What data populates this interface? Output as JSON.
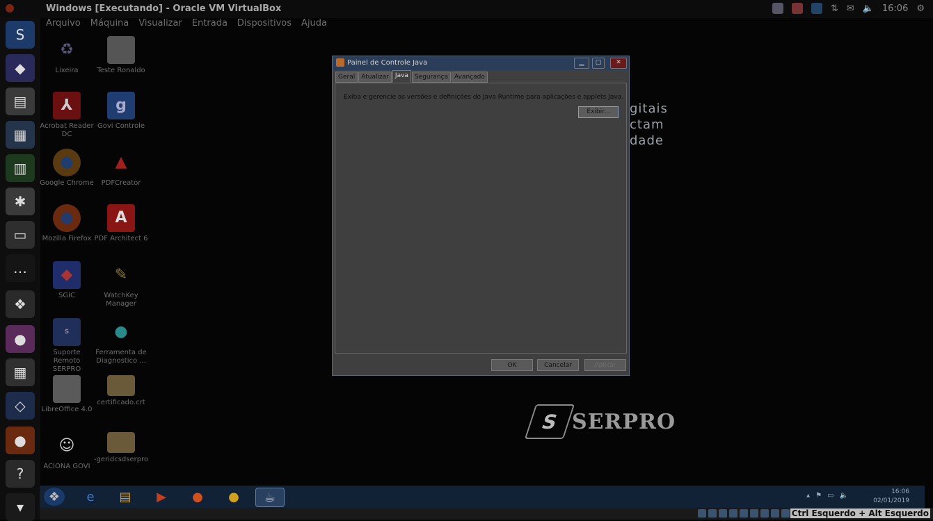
{
  "top_bar": {
    "window_title": "Windows [Executando] - Oracle VM VirtualBox",
    "clock": "16:06"
  },
  "menu": [
    "Arquivo",
    "Máquina",
    "Visualizar",
    "Entrada",
    "Dispositivos",
    "Ajuda"
  ],
  "desktop_icons": [
    {
      "label": "Lixeira",
      "icon": "recycle-bin-icon"
    },
    {
      "label": "Teste Ronaldo",
      "icon": "document-icon"
    },
    {
      "label": "Acrobat Reader DC",
      "icon": "acrobat-icon"
    },
    {
      "label": "Govi Controle",
      "icon": "govi-icon"
    },
    {
      "label": "Google Chrome",
      "icon": "chrome-icon"
    },
    {
      "label": "PDFCreator",
      "icon": "pdfcreator-icon"
    },
    {
      "label": "Mozilla Firefox",
      "icon": "firefox-icon"
    },
    {
      "label": "PDF Architect 6",
      "icon": "pdf-architect-icon"
    },
    {
      "label": "SGIC",
      "icon": "sgic-icon"
    },
    {
      "label": "WatchKey Manager",
      "icon": "watchkey-icon"
    },
    {
      "label": "Suporte Remoto SERPRO",
      "icon": "suporte-remoto-icon"
    },
    {
      "label": "Ferramenta de Diagnostico ...",
      "icon": "diagnostic-icon"
    },
    {
      "label": "LibreOffice 4.0",
      "icon": "libreoffice-icon"
    },
    {
      "label": "certificado.crt",
      "icon": "certificate-icon"
    },
    {
      "label": "ACIONA GOVI",
      "icon": "robot-icon"
    },
    {
      "label": "-geridcsdserpro",
      "icon": "certificate-icon"
    }
  ],
  "background_text": [
    "gitais",
    "ctam",
    "dade"
  ],
  "background_logo": "SERPRO",
  "dialog": {
    "title": "Painel de Controle Java",
    "tabs": [
      "Geral",
      "Atualizar",
      "Java",
      "Segurança",
      "Avançado"
    ],
    "active_tab": "Java",
    "description": "Exiba e gerencie as versões e definições do Java Runtime para aplicações e applets Java.",
    "view_button": "Exibir...",
    "ok_button": "OK",
    "cancel_button": "Cancelar",
    "apply_button": "Aplicar"
  },
  "taskbar": {
    "time": "16:06",
    "date": "02/01/2019"
  },
  "vbox_status": {
    "host_key": "Ctrl Esquerdo + Alt Esquerdo"
  }
}
